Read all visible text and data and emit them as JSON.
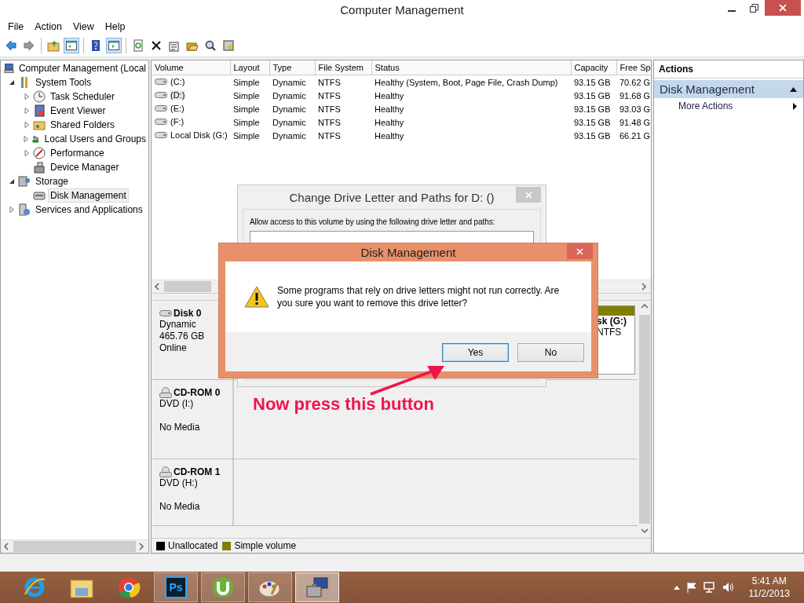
{
  "window": {
    "title": "Computer Management"
  },
  "menu": [
    "File",
    "Action",
    "View",
    "Help"
  ],
  "toolbar": [
    {
      "kind": "back",
      "disabled": false
    },
    {
      "kind": "forward",
      "disabled": true
    },
    {
      "kind": "sep"
    },
    {
      "kind": "up",
      "pressed": false
    },
    {
      "kind": "tree",
      "pressed": true
    },
    {
      "kind": "sep"
    },
    {
      "kind": "help",
      "pressed": false
    },
    {
      "kind": "pane",
      "pressed": true
    },
    {
      "kind": "sep"
    },
    {
      "kind": "refresh"
    },
    {
      "kind": "delete"
    },
    {
      "kind": "properties"
    },
    {
      "kind": "open"
    },
    {
      "kind": "search"
    },
    {
      "kind": "settings"
    }
  ],
  "tree": [
    {
      "label": "Computer Management (Local",
      "children": [
        {
          "label": "System Tools",
          "expanded": true,
          "children": [
            {
              "label": "Task Scheduler",
              "expanded": false,
              "selected": false
            },
            {
              "label": "Event Viewer",
              "expanded": false,
              "selected": false
            },
            {
              "label": "Shared Folders",
              "expanded": false,
              "selected": false
            },
            {
              "label": "Local Users and Groups",
              "expanded": false,
              "selected": false
            },
            {
              "label": "Performance",
              "expanded": false,
              "selected": false
            },
            {
              "label": "Device Manager",
              "selected": false
            }
          ],
          "selected": false
        },
        {
          "label": "Storage",
          "expanded": true,
          "selected": false,
          "children": [
            {
              "label": "Disk Management",
              "selected": true
            }
          ]
        },
        {
          "label": "Services and Applications",
          "expanded": false,
          "selected": false
        }
      ],
      "selected": false
    }
  ],
  "table": {
    "columns": [
      "Volume",
      "Layout",
      "Type",
      "File System",
      "Status",
      "Capacity",
      "Free Sp"
    ],
    "rows": [
      {
        "selected": false,
        "cells": [
          "(C:)",
          "Simple",
          "Dynamic",
          "NTFS",
          "Healthy (System, Boot, Page File, Crash Dump)",
          "93.15 GB",
          "70.62 G"
        ]
      },
      {
        "selected": true,
        "cells": [
          "(D:)",
          "Simple",
          "Dynamic",
          "NTFS",
          "Healthy",
          "93.15 GB",
          "91.68 G"
        ]
      },
      {
        "selected": false,
        "cells": [
          "(E:)",
          "Simple",
          "Dynamic",
          "NTFS",
          "Healthy",
          "93.15 GB",
          "93.03 G"
        ]
      },
      {
        "selected": false,
        "cells": [
          "(F:)",
          "Simple",
          "Dynamic",
          "NTFS",
          "Healthy",
          "93.15 GB",
          "91.48 G"
        ]
      },
      {
        "selected": false,
        "cells": [
          "Local Disk (G:)",
          "Simple",
          "Dynamic",
          "NTFS",
          "Healthy",
          "93.15 GB",
          "66.21 G"
        ]
      }
    ]
  },
  "disks": [
    {
      "kind": "disk",
      "name": "Disk 0",
      "type": "Dynamic",
      "size": "465.76 GB",
      "status": "Online",
      "partition": {
        "label": "sk  (G:)",
        "file_system": "NTFS",
        "color": "#808000"
      }
    },
    {
      "kind": "cdrom",
      "name": "CD-ROM 0",
      "type": "DVD (I:)",
      "status": "No Media"
    },
    {
      "kind": "cdrom",
      "name": "CD-ROM 1",
      "type": "DVD (H:)",
      "status": "No Media"
    }
  ],
  "legend": [
    {
      "label": "Unallocated",
      "color": "#000000"
    },
    {
      "label": "Simple volume",
      "color": "#808000"
    }
  ],
  "actions": {
    "title": "Actions",
    "section": {
      "label": "Disk Management",
      "expanded": true
    },
    "items": [
      "More Actions"
    ]
  },
  "back_dialog": {
    "title": "Change Drive Letter and Paths for D: ()",
    "prompt": "Allow access to this volume by using the following drive letter and paths:"
  },
  "dialog": {
    "title": "Disk Management",
    "message": "Some programs that rely on drive letters might not run correctly. Are you sure you want to remove this drive letter?",
    "buttons": [
      {
        "label": "Yes",
        "selected": true
      },
      {
        "label": "No",
        "selected": false
      }
    ]
  },
  "annotation": {
    "text": "Now press this button"
  },
  "taskbar": {
    "apps": [
      {
        "kind": "ie",
        "running": false,
        "selected": false
      },
      {
        "kind": "explorer",
        "running": false,
        "selected": false
      },
      {
        "kind": "chrome",
        "running": false,
        "selected": false
      },
      {
        "kind": "photoshop",
        "badge": "Ps",
        "running": true,
        "selected": false
      },
      {
        "kind": "torrent",
        "running": true,
        "selected": false
      },
      {
        "kind": "paint",
        "running": true,
        "selected": false
      },
      {
        "kind": "compmgmt",
        "running": true,
        "selected": true
      }
    ],
    "time": "5:41 AM",
    "date": "11/2/2013"
  }
}
